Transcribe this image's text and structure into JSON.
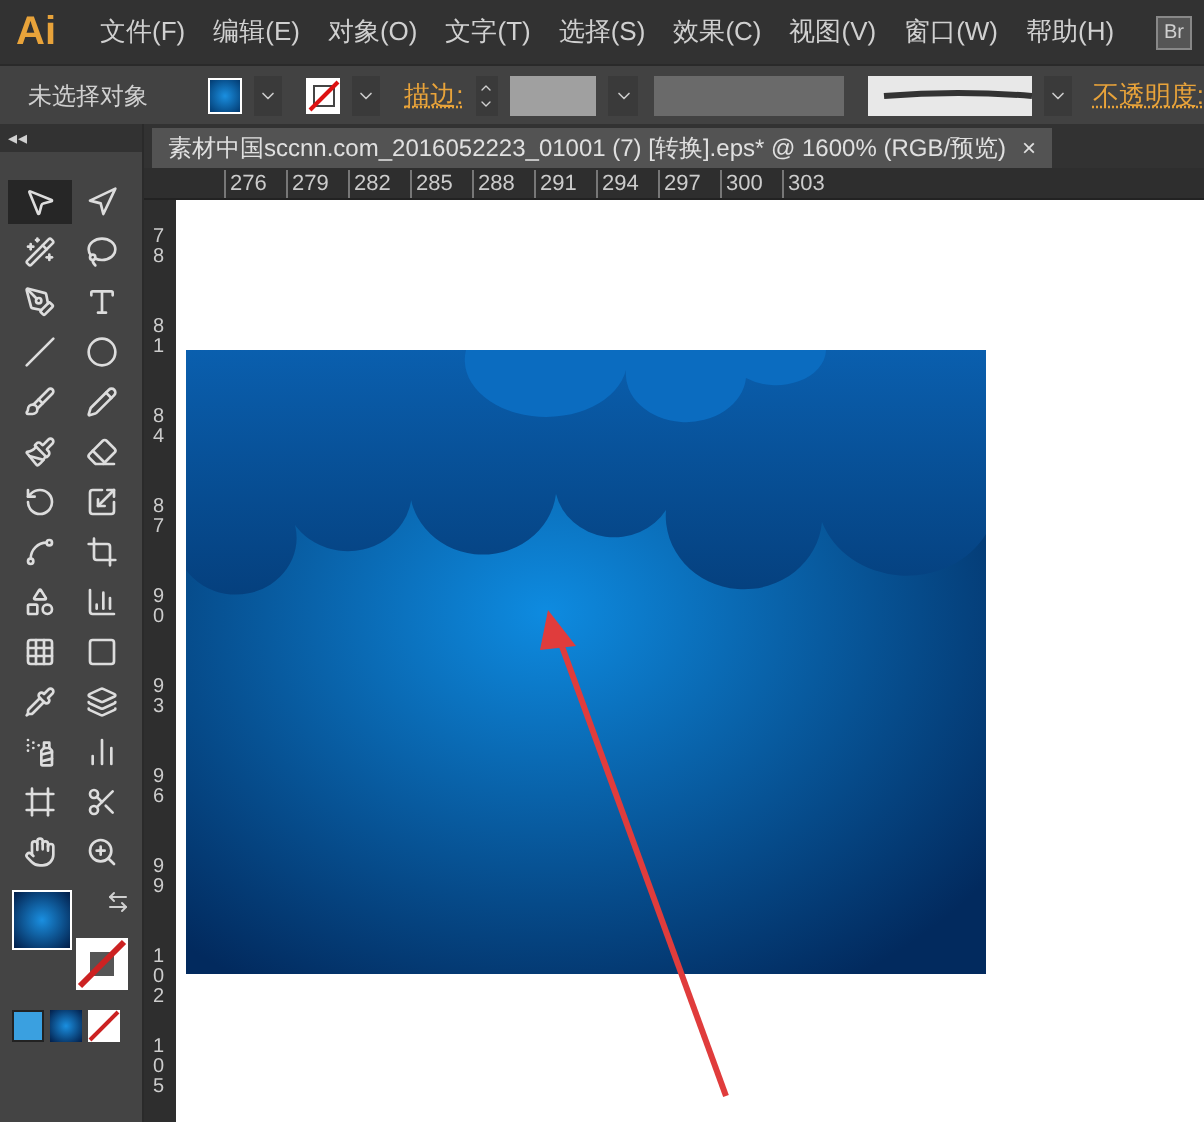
{
  "app": {
    "logo": "Ai"
  },
  "menu": [
    "文件(F)",
    "编辑(E)",
    "对象(O)",
    "文字(T)",
    "选择(S)",
    "效果(C)",
    "视图(V)",
    "窗口(W)",
    "帮助(H)"
  ],
  "bridge_button": "Br",
  "control_bar": {
    "selection_label": "未选择对象",
    "stroke_label": "描边:",
    "opacity_label": "不透明度:"
  },
  "panel_collapse": "◂◂",
  "document_tab": {
    "title": "素材中国sccnn.com_2016052223_01001  (7)  [转换].eps* @ 1600% (RGB/预览)",
    "close": "×",
    "selected": true
  },
  "horizontal_ruler": [
    "276",
    "279",
    "282",
    "285",
    "288",
    "291",
    "294",
    "297",
    "300",
    "303"
  ],
  "vertical_ruler": [
    "78",
    "81",
    "84",
    "87",
    "90",
    "93",
    "96",
    "99",
    "102",
    "105"
  ],
  "tools": [
    {
      "kind": "selection",
      "selected": true
    },
    {
      "kind": "direct",
      "selected": false
    },
    {
      "kind": "wand",
      "selected": false
    },
    {
      "kind": "lasso",
      "selected": false
    },
    {
      "kind": "pen",
      "selected": false
    },
    {
      "kind": "type",
      "selected": false
    },
    {
      "kind": "line",
      "selected": false
    },
    {
      "kind": "ellipse",
      "selected": false
    },
    {
      "kind": "brush",
      "selected": false
    },
    {
      "kind": "pencil",
      "selected": false
    },
    {
      "kind": "blob",
      "selected": false
    },
    {
      "kind": "eraser",
      "selected": false
    },
    {
      "kind": "rotate",
      "selected": false
    },
    {
      "kind": "scale",
      "selected": false
    },
    {
      "kind": "warp",
      "selected": false
    },
    {
      "kind": "transform",
      "selected": false
    },
    {
      "kind": "shape",
      "selected": false
    },
    {
      "kind": "graph",
      "selected": false
    },
    {
      "kind": "mesh",
      "selected": false
    },
    {
      "kind": "gradient",
      "selected": false
    },
    {
      "kind": "eyedropper",
      "selected": false
    },
    {
      "kind": "blend",
      "selected": false
    },
    {
      "kind": "spray",
      "selected": false
    },
    {
      "kind": "column",
      "selected": false
    },
    {
      "kind": "artboard",
      "selected": false
    },
    {
      "kind": "slice",
      "selected": false
    },
    {
      "kind": "hand",
      "selected": false
    },
    {
      "kind": "zoom",
      "selected": false
    }
  ]
}
